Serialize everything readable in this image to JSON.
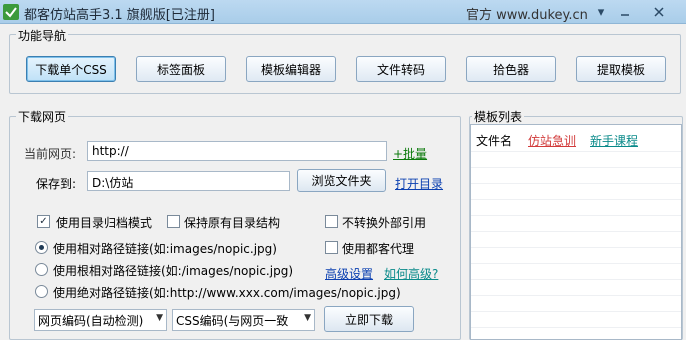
{
  "window": {
    "title": "都客仿站高手3.1 旗舰版[已注册]",
    "official_site": "官方 www.dukey.cn",
    "icons": [
      "app-icon",
      "dropdown-icon",
      "minimize-icon",
      "close-icon"
    ]
  },
  "nav": {
    "legend": "功能导航",
    "buttons": [
      "下载单个CSS",
      "标签面板",
      "模板编辑器",
      "文件转码",
      "拾色器",
      "提取模板"
    ]
  },
  "download": {
    "legend": "下载网页",
    "current_label": "当前网页:",
    "current_value": "http://",
    "batch_link": "+批量",
    "saveto_label": "保存到:",
    "saveto_value": "D:\\仿站",
    "browse_button": "浏览文件夹",
    "open_dir_link": "打开目录",
    "options": {
      "dir_archive": "使用目录归档模式",
      "keep_structure": "保持原有目录结构",
      "no_convert_external": "不转换外部引用",
      "use_proxy": "使用都客代理",
      "relative_path": "使用相对路径链接(如:images/nopic.jpg)",
      "root_relative_path": "使用根相对路径链接(如:/images/nopic.jpg)",
      "absolute_path": "使用绝对路径链接(如:http://www.xxx.com/images/nopic.jpg)"
    },
    "advanced_link": "高级设置",
    "how_advanced_link": "如何高级?",
    "page_encoding": "网页编码(自动检测)",
    "css_encoding": "CSS编码(与网页一致",
    "download_button": "立即下载"
  },
  "templates": {
    "legend": "模板列表",
    "col_filename": "文件名",
    "link_imitation": "仿站急训",
    "link_tutorial": "新手课程"
  },
  "state": {
    "dir_archive_checked": true,
    "keep_structure_checked": false,
    "no_convert_external_checked": false,
    "use_proxy_checked": false,
    "selected_link_mode": "relative_path"
  },
  "colors": {
    "titlebar": "#b4d4ee",
    "active_button": "#bfe1f7",
    "link_green": "#0b7a0b",
    "link_blue": "#0a3fb0",
    "link_red": "#d23b3b"
  }
}
